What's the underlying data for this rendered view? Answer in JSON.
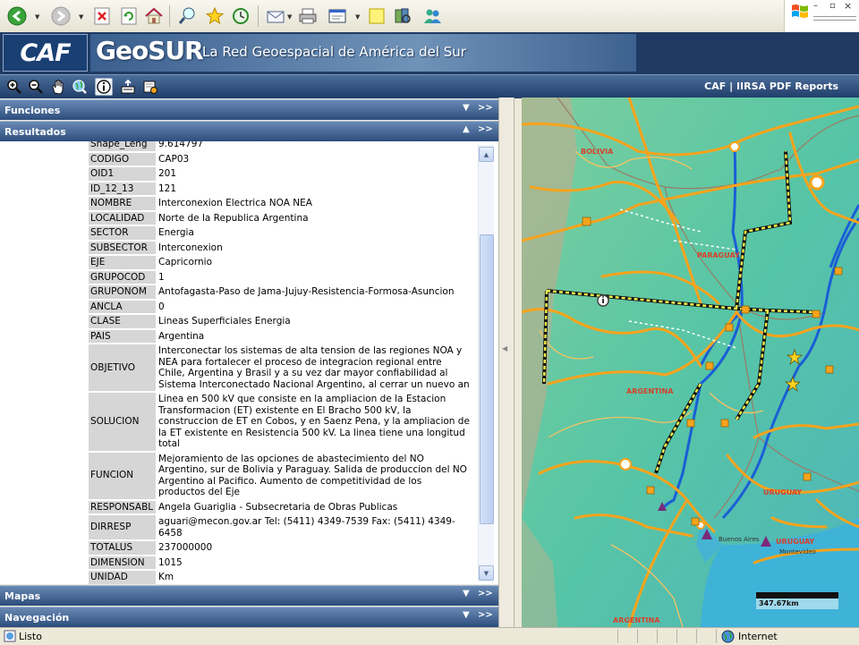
{
  "browser": {
    "status_text": "Listo",
    "zone_text": "Internet"
  },
  "banner": {
    "caf_logo": "CAF",
    "geosur_logo": "GeoSUR",
    "tagline": "La Red Geoespacial de América del Sur"
  },
  "toolbar": {
    "reports_label": "CAF | IIRSA PDF Reports",
    "tools": [
      "zoom-in-icon",
      "zoom-out-icon",
      "pan-hand-icon",
      "full-extent-icon",
      "info-icon",
      "export-icon",
      "print-icon"
    ]
  },
  "panels": {
    "funciones": "Funciones",
    "resultados": "Resultados",
    "mapas": "Mapas",
    "navegacion": "Navegación"
  },
  "results": {
    "partial_row": {
      "key": "Shape_Leng",
      "value": "9.614797"
    },
    "rows": [
      {
        "key": "CODIGO",
        "value": "CAP03"
      },
      {
        "key": "OID1",
        "value": "201"
      },
      {
        "key": "ID_12_13",
        "value": "121"
      },
      {
        "key": "NOMBRE",
        "value": "Interconexion Electrica NOA NEA"
      },
      {
        "key": "LOCALIDAD",
        "value": "Norte de la Republica Argentina"
      },
      {
        "key": "SECTOR",
        "value": "Energia"
      },
      {
        "key": "SUBSECTOR",
        "value": "Interconexion"
      },
      {
        "key": "EJE",
        "value": "Capricornio"
      },
      {
        "key": "GRUPOCOD",
        "value": "1"
      },
      {
        "key": "GRUPONOM",
        "value": "Antofagasta-Paso de Jama-Jujuy-Resistencia-Formosa-Asuncion"
      },
      {
        "key": "ANCLA",
        "value": "0"
      },
      {
        "key": "CLASE",
        "value": "Lineas Superficiales Energia"
      },
      {
        "key": "PAIS",
        "value": "Argentina"
      },
      {
        "key": "OBJETIVO",
        "value": "Interconectar los sistemas de alta tension de las regiones NOA y NEA para fortalecer el proceso de integracion regional entre Chile, Argentina y Brasil y a su vez dar mayor confiabilidad al Sistema Interconectado Nacional Argentino, al cerrar un nuevo an"
      },
      {
        "key": "SOLUCION",
        "value": "Linea en 500 kV que consiste en la ampliacion de la Estacion Transformacion (ET) existente en El Bracho 500 kV, la construccion de ET en Cobos, y en Saenz Pena, y la ampliacion de la ET existente en Resistencia 500 kV. La linea tiene una longitud total"
      },
      {
        "key": "FUNCION",
        "value": "Mejoramiento de las opciones de abastecimiento del NO Argentino, sur de Bolivia y Paraguay. Salida de produccion del NO Argentino al Pacifico. Aumento de competitividad de los productos del Eje"
      },
      {
        "key": "RESPONSABL",
        "value": "Angela Guariglia - Subsecretaria de Obras Publicas"
      },
      {
        "key": "DIRRESP",
        "value": "aguari@mecon.gov.ar Tel: (5411) 4349-7539 Fax: (5411) 4349-6458"
      },
      {
        "key": "TOTALUS",
        "value": "237000000"
      },
      {
        "key": "DIMENSION",
        "value": "1015"
      },
      {
        "key": "UNIDAD",
        "value": "Km"
      }
    ]
  },
  "map": {
    "labels": {
      "bolivia": "BOLIVIA",
      "paraguay": "PARAGUAY",
      "argentina": "ARGENTINA",
      "uruguay": "URUGUAY",
      "uruguay2": "URUGUAY",
      "buenos_aires": "Buenos Aires",
      "montevideo": "Montevideo",
      "argentina2": "ARGENTINA"
    },
    "scale_text": "347.67km",
    "colors": {
      "roads": "#f7a31c",
      "rivers": "#1a5fd6",
      "land": "#5cc7a3",
      "labels": "#d8402c"
    }
  }
}
